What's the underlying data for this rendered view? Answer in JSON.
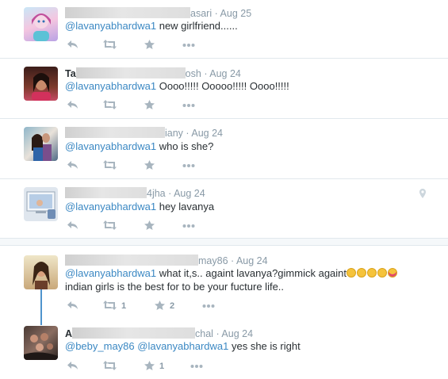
{
  "tweets": [
    {
      "name_prefix": "",
      "name_suffix": "asari",
      "date": "· Aug 25",
      "mentions": [
        "@lavanyabhardwa1"
      ],
      "text": " new girlfriend......",
      "retweets": "",
      "favorites": ""
    },
    {
      "name_prefix": "Ta",
      "name_suffix": "osh",
      "date": "· Aug 24",
      "mentions": [
        "@lavanyabhardwa1"
      ],
      "text": "  Oooo!!!!! Ooooo!!!!! Oooo!!!!!",
      "retweets": "",
      "favorites": ""
    },
    {
      "name_prefix": "",
      "name_suffix": "iany",
      "date": "· Aug 24",
      "mentions": [
        "@lavanyabhardwa1"
      ],
      "text": " who is she?",
      "retweets": "",
      "favorites": ""
    },
    {
      "name_prefix": "",
      "name_suffix": "4jha",
      "date": "· Aug 24",
      "mentions": [
        "@lavanyabhardwa1"
      ],
      "text": " hey lavanya",
      "retweets": "",
      "favorites": ""
    },
    {
      "name_prefix": "",
      "name_suffix": "may86",
      "date": "· Aug 24",
      "mentions": [
        "@lavanyabhardwa1"
      ],
      "text": " what it,s.. againt lavanya?gimmick againt",
      "text_line2": "indian girls is the best for to be your fucture life..",
      "retweets": "1",
      "favorites": "2"
    },
    {
      "name_prefix": "A",
      "name_suffix": "chal",
      "date": "· Aug 24",
      "mentions": [
        "@beby_may86",
        "@lavanyabhardwa1"
      ],
      "text": " yes she is right",
      "retweets": "",
      "favorites": "1"
    }
  ],
  "icons": {
    "reply": "reply-icon",
    "retweet": "retweet-icon",
    "favorite": "star-icon",
    "more": "more-icon",
    "location": "location-pin-icon"
  },
  "colors": {
    "mention": "#3b88c3",
    "meta": "#8899a6",
    "action": "#a8b5bf",
    "thread": "#4f94cd"
  }
}
